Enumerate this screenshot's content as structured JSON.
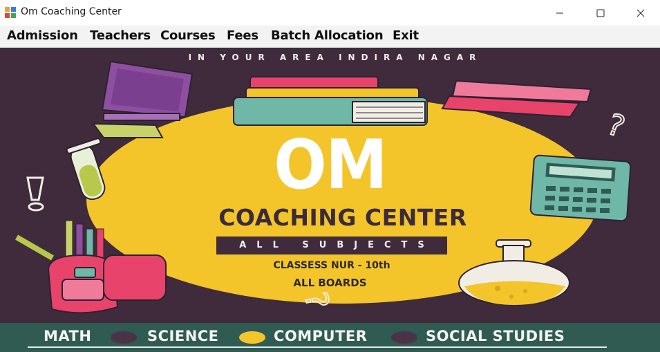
{
  "window": {
    "title": "Om Coaching Center",
    "controls": {
      "minimize": "—",
      "maximize": "☐",
      "close": "✕"
    }
  },
  "menu": {
    "items": [
      "Admission",
      "Teachers",
      "Courses",
      "Fees",
      "Batch Allocation",
      "Exit"
    ]
  },
  "poster": {
    "tagline": "IN YOUR AREA INDIRA NAGAR",
    "headline": "OM",
    "subtitle": "COACHING CENTER",
    "subjects_banner": "ALL SUBJECTS",
    "classes": "CLASSESS  NUR - 10th",
    "boards": "ALL BOARDS",
    "subjects": [
      "MATH",
      "SCIENCE",
      "COMPUTER",
      "SOCIAL STUDIES"
    ]
  },
  "colors": {
    "background": "#3f2b3c",
    "circle": "#f3c52b",
    "footer": "#2f5b53",
    "dot_dark": "#4a3346",
    "dot_yellow": "#f3c52b"
  },
  "icons": [
    "app-icon",
    "books-icon",
    "monitor-icon",
    "stapler-icon",
    "question-mark-icon",
    "test-tube-icon",
    "exclamation-icon",
    "calculator-icon",
    "backpack-icon",
    "flask-icon"
  ]
}
